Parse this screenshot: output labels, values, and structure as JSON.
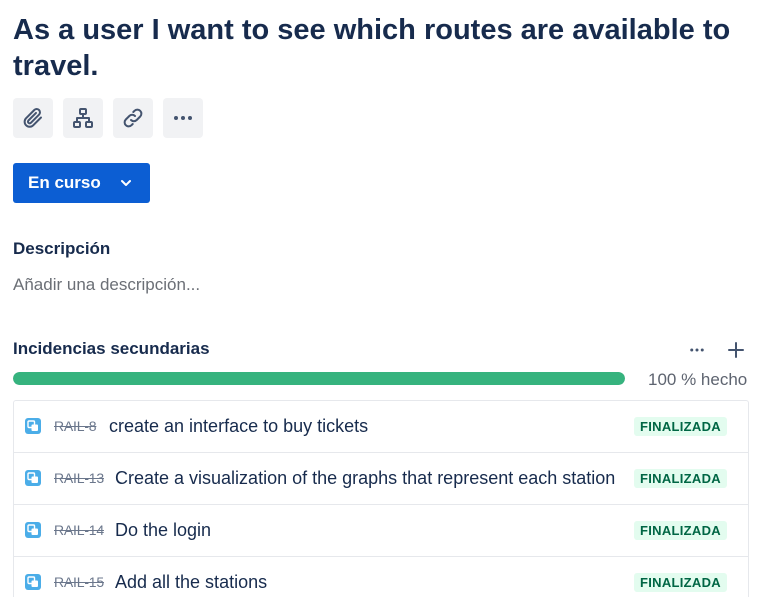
{
  "issue": {
    "title": "As a user I want to see which routes are available to travel."
  },
  "toolbar": {
    "icons": [
      "paperclip-icon",
      "hierarchy-icon",
      "link-icon",
      "more-icon"
    ]
  },
  "status": {
    "label": "En curso",
    "color": "#0c5ed3"
  },
  "description": {
    "heading": "Descripción",
    "placeholder": "Añadir una descripción..."
  },
  "subtasks": {
    "heading": "Incidencias secundarias",
    "progress_fraction": 1.0,
    "progress_label": "100 % hecho",
    "progress_color": "#36b37e",
    "items": [
      {
        "key": "RAIL-8",
        "summary": "create an interface to buy tickets",
        "status": "FINALIZADA"
      },
      {
        "key": "RAIL-13",
        "summary": "Create a visualization of the graphs that represent each station",
        "status": "FINALIZADA"
      },
      {
        "key": "RAIL-14",
        "summary": "Do the login",
        "status": "FINALIZADA"
      },
      {
        "key": "RAIL-15",
        "summary": "Add all the stations",
        "status": "FINALIZADA"
      }
    ]
  }
}
